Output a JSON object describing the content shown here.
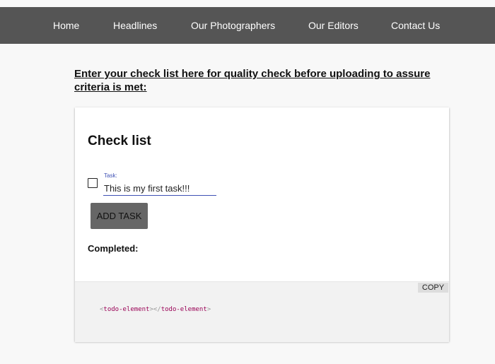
{
  "nav": {
    "items": [
      {
        "label": "Home"
      },
      {
        "label": "Headlines"
      },
      {
        "label": "Our Photographers"
      },
      {
        "label": "Our Editors"
      },
      {
        "label": "Contact Us"
      }
    ]
  },
  "main": {
    "heading": "Enter your check list here for quality check before uploading to assure criteria is met:"
  },
  "checklist": {
    "title": "Check list",
    "task_checkbox_checked": false,
    "task_label": "Task:",
    "task_value": "This is my first task!!!",
    "add_button_label": "ADD TASK",
    "completed_label": "Completed:"
  },
  "code_block": {
    "copy_label": "COPY",
    "open_tag_lt": "<",
    "open_tag_name": "todo-element",
    "open_tag_gt": "></",
    "close_tag_name": "todo-element",
    "close_tag_gt": ">"
  },
  "colors": {
    "navbar_bg": "#555555",
    "accent": "#3f51b5",
    "button_bg": "#666666",
    "code_tag": "#990055"
  }
}
